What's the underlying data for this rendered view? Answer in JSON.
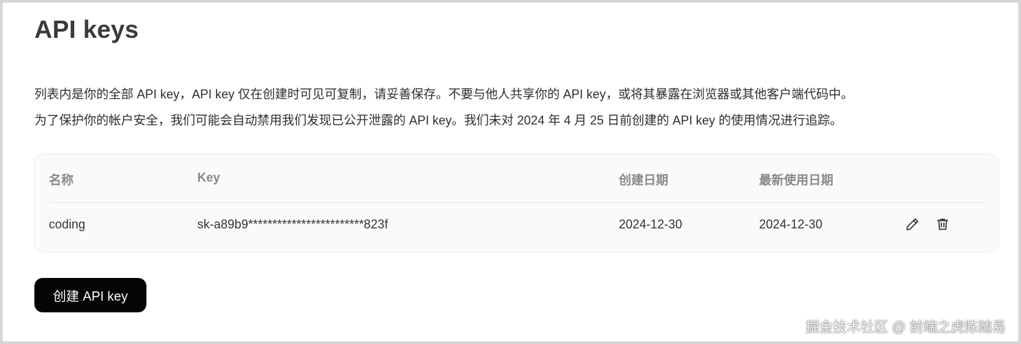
{
  "page": {
    "title": "API keys",
    "description": [
      "列表内是你的全部 API key，API key 仅在创建时可见可复制，请妥善保存。不要与他人共享你的 API key，或将其暴露在浏览器或其他客户端代码中。",
      "为了保护你的帐户安全，我们可能会自动禁用我们发现已公开泄露的 API key。我们未对 2024 年 4 月 25 日前创建的 API key 的使用情况进行追踪。"
    ]
  },
  "table": {
    "columns": [
      "名称",
      "Key",
      "创建日期",
      "最新使用日期"
    ],
    "rows": [
      {
        "name": "coding",
        "key": "sk-a89b9************************823f",
        "created": "2024-12-30",
        "last_used": "2024-12-30",
        "actions": [
          "pencil-icon",
          "trash-icon"
        ]
      }
    ]
  },
  "create_button": {
    "label": "创建 API key"
  },
  "watermark": "掘金技术社区 @ 前端之虎陈随易",
  "colors": {
    "button_bg": "#050505",
    "button_text": "#ffffff",
    "card_bg": "#fafafa",
    "header_text": "#8a8a8a"
  }
}
